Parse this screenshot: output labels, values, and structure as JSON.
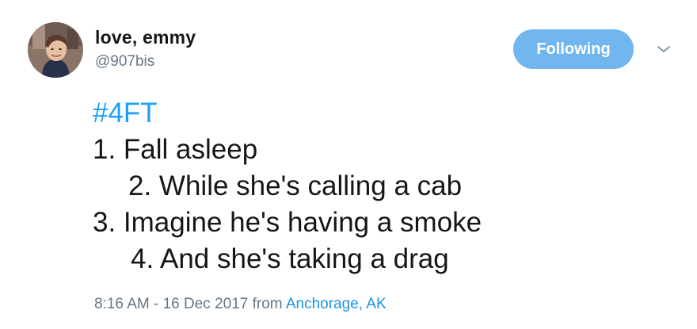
{
  "author": {
    "name": "love, emmy",
    "handle": "@907bis"
  },
  "follow_button": {
    "label": "Following",
    "color": "#71b6ef"
  },
  "menu": {
    "icon": "chevron-down-icon"
  },
  "tweet": {
    "hashtag": "#4FT",
    "lines": [
      "1. Fall asleep",
      "2. While she's calling a cab",
      "3. Imagine he's having a smoke",
      "4. And she's taking a drag"
    ]
  },
  "meta": {
    "timestamp": "8:16 AM - 16 Dec 2017",
    "from_label": "from",
    "location": "Anchorage, AK"
  },
  "colors": {
    "text": "#14171a",
    "secondary": "#657786",
    "link": "#1da1f2"
  }
}
